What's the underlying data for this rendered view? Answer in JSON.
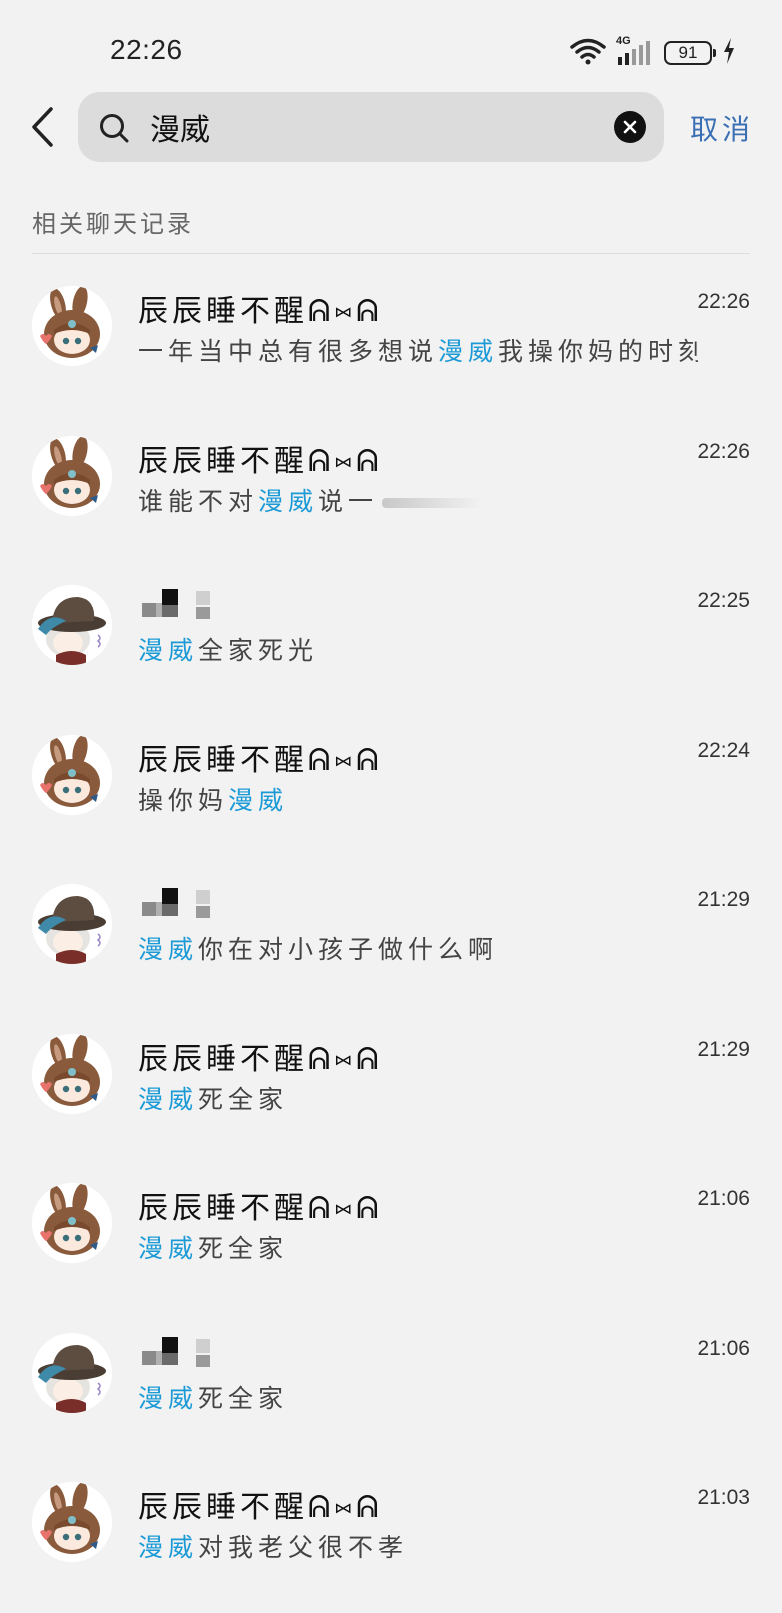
{
  "status_bar": {
    "time": "22:26",
    "network": "4G",
    "battery": "91"
  },
  "search": {
    "query": "漫威",
    "cancel_label": "取消"
  },
  "section_title": "相关聊天记录",
  "highlight_color": "#1c9ad6",
  "accent_color": "#3a6fb4",
  "results": [
    {
      "sender": "辰辰睡不醒ᕱ⑅ᕱ",
      "avatar": "bunny-girl-avatar",
      "time": "22:26",
      "before": "一年当中总有很多想说",
      "keyword": "漫威",
      "after": "我操你妈的时刻"
    },
    {
      "sender": "辰辰睡不醒ᕱ⑅ᕱ",
      "avatar": "bunny-girl-avatar",
      "time": "22:26",
      "before": "谁能不对",
      "keyword": "漫威",
      "after": "说一"
    },
    {
      "sender": "",
      "avatar": "hat-character-avatar",
      "time": "22:25",
      "before": "",
      "keyword": "漫威",
      "after": "全家死光"
    },
    {
      "sender": "辰辰睡不醒ᕱ⑅ᕱ",
      "avatar": "bunny-girl-avatar",
      "time": "22:24",
      "before": "操你妈",
      "keyword": "漫威",
      "after": ""
    },
    {
      "sender": "",
      "avatar": "hat-character-avatar",
      "time": "21:29",
      "before": "",
      "keyword": "漫威",
      "after": "你在对小孩子做什么啊"
    },
    {
      "sender": "辰辰睡不醒ᕱ⑅ᕱ",
      "avatar": "bunny-girl-avatar",
      "time": "21:29",
      "before": "",
      "keyword": "漫威",
      "after": "死全家"
    },
    {
      "sender": "辰辰睡不醒ᕱ⑅ᕱ",
      "avatar": "bunny-girl-avatar",
      "time": "21:06",
      "before": "",
      "keyword": "漫威",
      "after": "死全家"
    },
    {
      "sender": "",
      "avatar": "hat-character-avatar",
      "time": "21:06",
      "before": "",
      "keyword": "漫威",
      "after": "死全家"
    },
    {
      "sender": "辰辰睡不醒ᕱ⑅ᕱ",
      "avatar": "bunny-girl-avatar",
      "time": "21:03",
      "before": "",
      "keyword": "漫威",
      "after": "对我老父很不孝"
    }
  ]
}
